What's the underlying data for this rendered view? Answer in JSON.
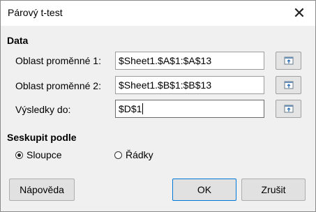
{
  "window": {
    "title": "Párový t-test",
    "close_icon": "close-icon"
  },
  "data_section": {
    "title": "Data",
    "variable1": {
      "label": "Oblast proměnné 1:",
      "value": "$Sheet1.$A$1:$A$13"
    },
    "variable2": {
      "label": "Oblast proměnné 2:",
      "value": "$Sheet1.$B$1:$B$13"
    },
    "results": {
      "label": "Výsledky do:",
      "value": "$D$1"
    }
  },
  "group_section": {
    "title": "Seskupit podle",
    "options": [
      {
        "label": "Sloupce",
        "selected": true
      },
      {
        "label": "Řádky",
        "selected": false
      }
    ]
  },
  "buttons": {
    "help": "Nápověda",
    "ok": "OK",
    "cancel": "Zrušit"
  },
  "colors": {
    "default_border": "#0078d7",
    "background": "#f0f0f0"
  }
}
